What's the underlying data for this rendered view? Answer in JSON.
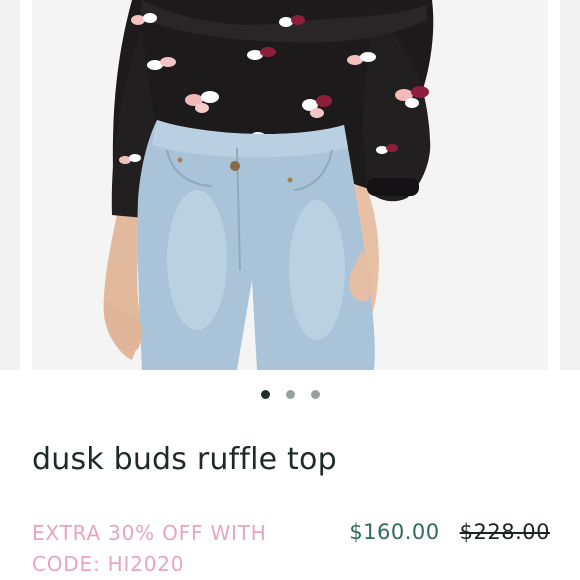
{
  "product": {
    "title": "dusk buds ruffle top",
    "promo_text": "EXTRA 30% OFF WITH CODE: HI2020",
    "price_current": "$160.00",
    "price_original": "$228.00",
    "image_description": "model wearing black floral ruffle top with light wash jeans"
  },
  "carousel": {
    "slide_count": 3,
    "active_index": 0
  },
  "colors": {
    "promo": "#e9a3c4",
    "price_current": "#2f6b5c",
    "title": "#1f2a28",
    "dot_active": "#1f2f2c",
    "dot_inactive": "#9aa0a0"
  }
}
